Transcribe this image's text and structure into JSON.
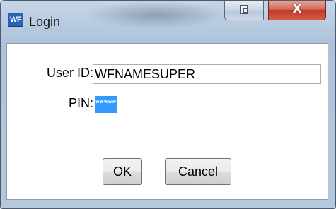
{
  "window": {
    "title": "Login",
    "app_icon_text": "WF"
  },
  "titlebar_buttons": {
    "restore_icon": "restore-icon",
    "close_icon": "close-icon",
    "close_glyph": "X"
  },
  "form": {
    "userid_label": "User ID:",
    "userid_value": "WFNAMESUPER",
    "pin_label": "PIN:",
    "pin_value": "*****"
  },
  "buttons": {
    "ok_mnemonic": "O",
    "ok_rest": "K",
    "cancel_mnemonic": "C",
    "cancel_rest": "ancel"
  },
  "colors": {
    "close_button": "#c0392b",
    "selection_highlight": "#3399ff"
  }
}
